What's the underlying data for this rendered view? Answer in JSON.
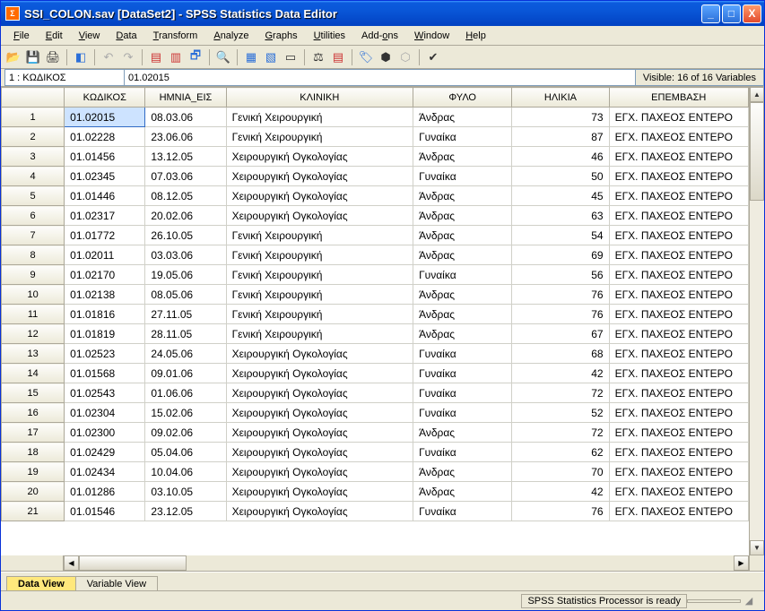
{
  "window": {
    "title": "SSI_COLON.sav [DataSet2] - SPSS Statistics Data Editor"
  },
  "menu": {
    "file": "File",
    "edit": "Edit",
    "view": "View",
    "data": "Data",
    "transform": "Transform",
    "analyze": "Analyze",
    "graphs": "Graphs",
    "utilities": "Utilities",
    "addons": "Add-ons",
    "window": "Window",
    "help": "Help"
  },
  "info": {
    "cellname": "1 : ΚΩΔΙΚΟΣ",
    "cellvalue": "01.02015",
    "visible": "Visible: 16 of 16 Variables"
  },
  "columns": [
    "ΚΩΔΙΚΟΣ",
    "ΗΜΝΙΑ_ΕΙΣ",
    "ΚΛΙΝΙΚΗ",
    "ΦΥΛΟ",
    "ΗΛΙΚΙΑ",
    "ΕΠΕΜΒΑΣΗ"
  ],
  "rows": [
    {
      "n": 1,
      "k": "01.02015",
      "d": "08.03.06",
      "c": "Γενική Χειρουργική",
      "s": "Άνδρας",
      "a": 73,
      "e": "ΕΓΧ. ΠΑΧΕΟΣ ΕΝΤΕΡΟ"
    },
    {
      "n": 2,
      "k": "01.02228",
      "d": "23.06.06",
      "c": "Γενική Χειρουργική",
      "s": "Γυναίκα",
      "a": 87,
      "e": "ΕΓΧ. ΠΑΧΕΟΣ ΕΝΤΕΡΟ"
    },
    {
      "n": 3,
      "k": "01.01456",
      "d": "13.12.05",
      "c": "Χειρουργική Ογκολογίας",
      "s": "Άνδρας",
      "a": 46,
      "e": "ΕΓΧ. ΠΑΧΕΟΣ ΕΝΤΕΡΟ"
    },
    {
      "n": 4,
      "k": "01.02345",
      "d": "07.03.06",
      "c": "Χειρουργική Ογκολογίας",
      "s": "Γυναίκα",
      "a": 50,
      "e": "ΕΓΧ. ΠΑΧΕΟΣ ΕΝΤΕΡΟ"
    },
    {
      "n": 5,
      "k": "01.01446",
      "d": "08.12.05",
      "c": "Χειρουργική Ογκολογίας",
      "s": "Άνδρας",
      "a": 45,
      "e": "ΕΓΧ. ΠΑΧΕΟΣ ΕΝΤΕΡΟ"
    },
    {
      "n": 6,
      "k": "01.02317",
      "d": "20.02.06",
      "c": "Χειρουργική Ογκολογίας",
      "s": "Άνδρας",
      "a": 63,
      "e": "ΕΓΧ. ΠΑΧΕΟΣ ΕΝΤΕΡΟ"
    },
    {
      "n": 7,
      "k": "01.01772",
      "d": "26.10.05",
      "c": "Γενική Χειρουργική",
      "s": "Άνδρας",
      "a": 54,
      "e": "ΕΓΧ. ΠΑΧΕΟΣ ΕΝΤΕΡΟ"
    },
    {
      "n": 8,
      "k": "01.02011",
      "d": "03.03.06",
      "c": "Γενική Χειρουργική",
      "s": "Άνδρας",
      "a": 69,
      "e": "ΕΓΧ. ΠΑΧΕΟΣ ΕΝΤΕΡΟ"
    },
    {
      "n": 9,
      "k": "01.02170",
      "d": "19.05.06",
      "c": "Γενική Χειρουργική",
      "s": "Γυναίκα",
      "a": 56,
      "e": "ΕΓΧ. ΠΑΧΕΟΣ ΕΝΤΕΡΟ"
    },
    {
      "n": 10,
      "k": "01.02138",
      "d": "08.05.06",
      "c": "Γενική Χειρουργική",
      "s": "Άνδρας",
      "a": 76,
      "e": "ΕΓΧ. ΠΑΧΕΟΣ ΕΝΤΕΡΟ"
    },
    {
      "n": 11,
      "k": "01.01816",
      "d": "27.11.05",
      "c": "Γενική Χειρουργική",
      "s": "Άνδρας",
      "a": 76,
      "e": "ΕΓΧ. ΠΑΧΕΟΣ ΕΝΤΕΡΟ"
    },
    {
      "n": 12,
      "k": "01.01819",
      "d": "28.11.05",
      "c": "Γενική Χειρουργική",
      "s": "Άνδρας",
      "a": 67,
      "e": "ΕΓΧ. ΠΑΧΕΟΣ ΕΝΤΕΡΟ"
    },
    {
      "n": 13,
      "k": "01.02523",
      "d": "24.05.06",
      "c": "Χειρουργική Ογκολογίας",
      "s": "Γυναίκα",
      "a": 68,
      "e": "ΕΓΧ. ΠΑΧΕΟΣ ΕΝΤΕΡΟ"
    },
    {
      "n": 14,
      "k": "01.01568",
      "d": "09.01.06",
      "c": "Χειρουργική Ογκολογίας",
      "s": "Γυναίκα",
      "a": 42,
      "e": "ΕΓΧ. ΠΑΧΕΟΣ ΕΝΤΕΡΟ"
    },
    {
      "n": 15,
      "k": "01.02543",
      "d": "01.06.06",
      "c": "Χειρουργική Ογκολογίας",
      "s": "Γυναίκα",
      "a": 72,
      "e": "ΕΓΧ. ΠΑΧΕΟΣ ΕΝΤΕΡΟ"
    },
    {
      "n": 16,
      "k": "01.02304",
      "d": "15.02.06",
      "c": "Χειρουργική Ογκολογίας",
      "s": "Γυναίκα",
      "a": 52,
      "e": "ΕΓΧ. ΠΑΧΕΟΣ ΕΝΤΕΡΟ"
    },
    {
      "n": 17,
      "k": "01.02300",
      "d": "09.02.06",
      "c": "Χειρουργική Ογκολογίας",
      "s": "Άνδρας",
      "a": 72,
      "e": "ΕΓΧ. ΠΑΧΕΟΣ ΕΝΤΕΡΟ"
    },
    {
      "n": 18,
      "k": "01.02429",
      "d": "05.04.06",
      "c": "Χειρουργική Ογκολογίας",
      "s": "Γυναίκα",
      "a": 62,
      "e": "ΕΓΧ. ΠΑΧΕΟΣ ΕΝΤΕΡΟ"
    },
    {
      "n": 19,
      "k": "01.02434",
      "d": "10.04.06",
      "c": "Χειρουργική Ογκολογίας",
      "s": "Άνδρας",
      "a": 70,
      "e": "ΕΓΧ. ΠΑΧΕΟΣ ΕΝΤΕΡΟ"
    },
    {
      "n": 20,
      "k": "01.01286",
      "d": "03.10.05",
      "c": "Χειρουργική Ογκολογίας",
      "s": "Άνδρας",
      "a": 42,
      "e": "ΕΓΧ. ΠΑΧΕΟΣ ΕΝΤΕΡΟ"
    },
    {
      "n": 21,
      "k": "01.01546",
      "d": "23.12.05",
      "c": "Χειρουργική Ογκολογίας",
      "s": "Γυναίκα",
      "a": 76,
      "e": "ΕΓΧ. ΠΑΧΕΟΣ ΕΝΤΕΡΟ"
    }
  ],
  "tabs": {
    "data": "Data View",
    "variable": "Variable View"
  },
  "status": {
    "msg": "SPSS Statistics Processor is ready"
  }
}
